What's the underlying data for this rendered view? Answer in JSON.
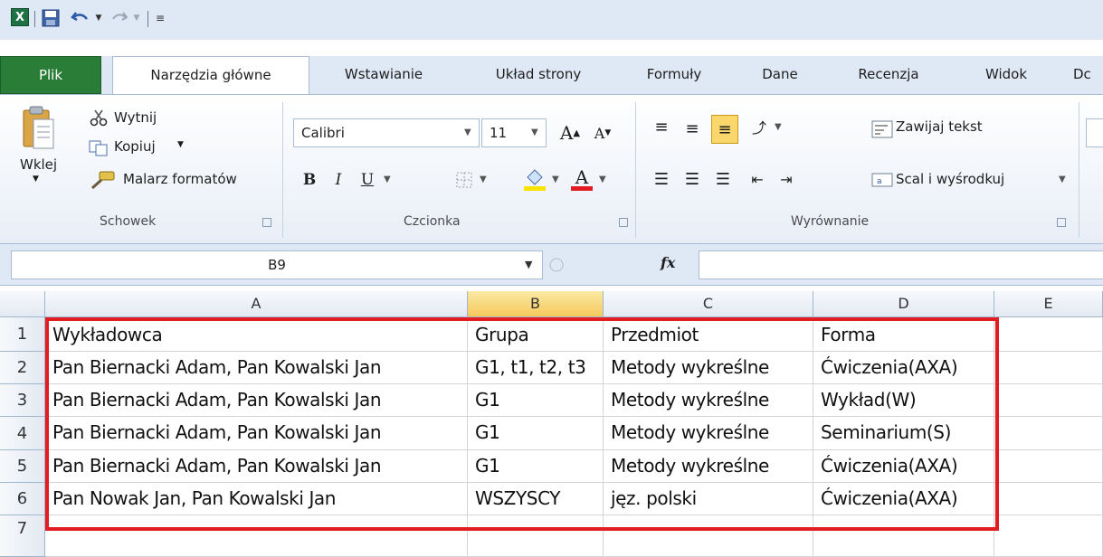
{
  "tabs": {
    "file": "Plik",
    "home": "Narzędzia główne",
    "insert": "Wstawianie",
    "layout": "Układ strony",
    "formulas": "Formuły",
    "data": "Dane",
    "review": "Recenzja",
    "view": "Widok",
    "dev": "Dc"
  },
  "clipboard": {
    "paste": "Wklej",
    "cut": "Wytnij",
    "copy": "Kopiuj",
    "painter": "Malarz formatów",
    "label": "Schowek"
  },
  "font": {
    "name": "Calibri",
    "size": "11",
    "label": "Czcionka",
    "bold": "B",
    "italic": "I",
    "underline": "U"
  },
  "alignment": {
    "wrap": "Zawijaj tekst",
    "merge": "Scal i wyśrodkuj",
    "label": "Wyrównanie"
  },
  "formula_bar": {
    "name_box": "B9",
    "fx": "fx"
  },
  "columns": [
    "A",
    "B",
    "C",
    "D",
    "E"
  ],
  "rows": [
    "1",
    "2",
    "3",
    "4",
    "5",
    "6",
    "7"
  ],
  "table": [
    [
      "Wykładowca",
      "Grupa",
      "Przedmiot",
      "Forma"
    ],
    [
      "Pan Biernacki Adam, Pan Kowalski Jan",
      "G1, t1, t2, t3",
      "Metody wykreślne",
      "Ćwiczenia(AXA)"
    ],
    [
      "Pan Biernacki Adam, Pan Kowalski Jan",
      "G1",
      "Metody wykreślne",
      "Wykład(W)"
    ],
    [
      "Pan Biernacki Adam, Pan Kowalski Jan",
      "G1",
      "Metody wykreślne",
      "Seminarium(S)"
    ],
    [
      "Pan Biernacki Adam, Pan Kowalski Jan",
      "G1",
      "Metody wykreślne",
      "Ćwiczenia(AXA)"
    ],
    [
      "Pan Nowak Jan, Pan Kowalski Jan",
      "WSZYSCY",
      "jęz. polski",
      "Ćwiczenia(AXA)"
    ]
  ],
  "colors": {
    "highlight": "#e31b23",
    "file_tab": "#2a7d36",
    "selected_header": "#f5c95c"
  }
}
